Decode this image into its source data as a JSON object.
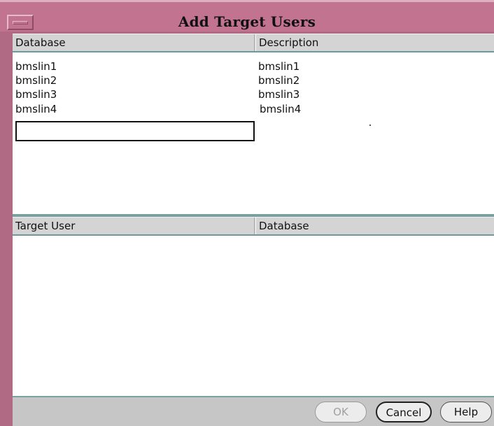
{
  "window": {
    "title": "Add Target Users"
  },
  "top_table": {
    "columns": [
      "Database",
      "Description"
    ],
    "rows": [
      [
        "bmslin1",
        "bmslin1"
      ],
      [
        "bmslin2",
        "bmslin2"
      ],
      [
        "bmslin3",
        "bmslin3"
      ],
      [
        "bmslin4",
        "bmslin4"
      ]
    ],
    "new_entry_value": ""
  },
  "bottom_table": {
    "columns": [
      "Target User",
      "Database"
    ],
    "rows": []
  },
  "buttons": {
    "ok_label": "OK",
    "cancel_label": "Cancel",
    "help_label": "Help"
  },
  "colors": {
    "title_bar": "#c2738f",
    "header_bg": "#d4d4d4",
    "accent_line": "#7aa0a0"
  }
}
